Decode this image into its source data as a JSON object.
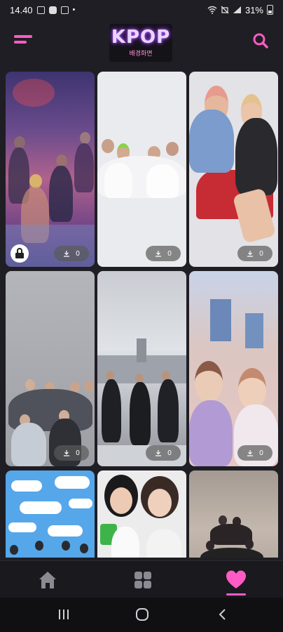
{
  "status_bar": {
    "time": "14.40",
    "dot": "•",
    "battery": "31%"
  },
  "header": {
    "logo_title": "KPOP",
    "logo_subtitle": "배경화면"
  },
  "wallpapers": [
    {
      "downloads": "0",
      "locked": true
    },
    {
      "downloads": "0",
      "locked": false
    },
    {
      "downloads": "0",
      "locked": false
    },
    {
      "downloads": "0",
      "locked": false
    },
    {
      "downloads": "0",
      "locked": false
    },
    {
      "downloads": "0",
      "locked": false
    }
  ],
  "colors": {
    "accent": "#ff5bc4",
    "background": "#1f1e24",
    "nav_icon": "#8a8a92"
  },
  "bottom_nav": [
    {
      "icon": "home-icon",
      "active": false
    },
    {
      "icon": "grid-icon",
      "active": false
    },
    {
      "icon": "heart-icon",
      "active": true
    }
  ],
  "system_nav": [
    "recents-icon",
    "home-circle-icon",
    "back-icon"
  ]
}
